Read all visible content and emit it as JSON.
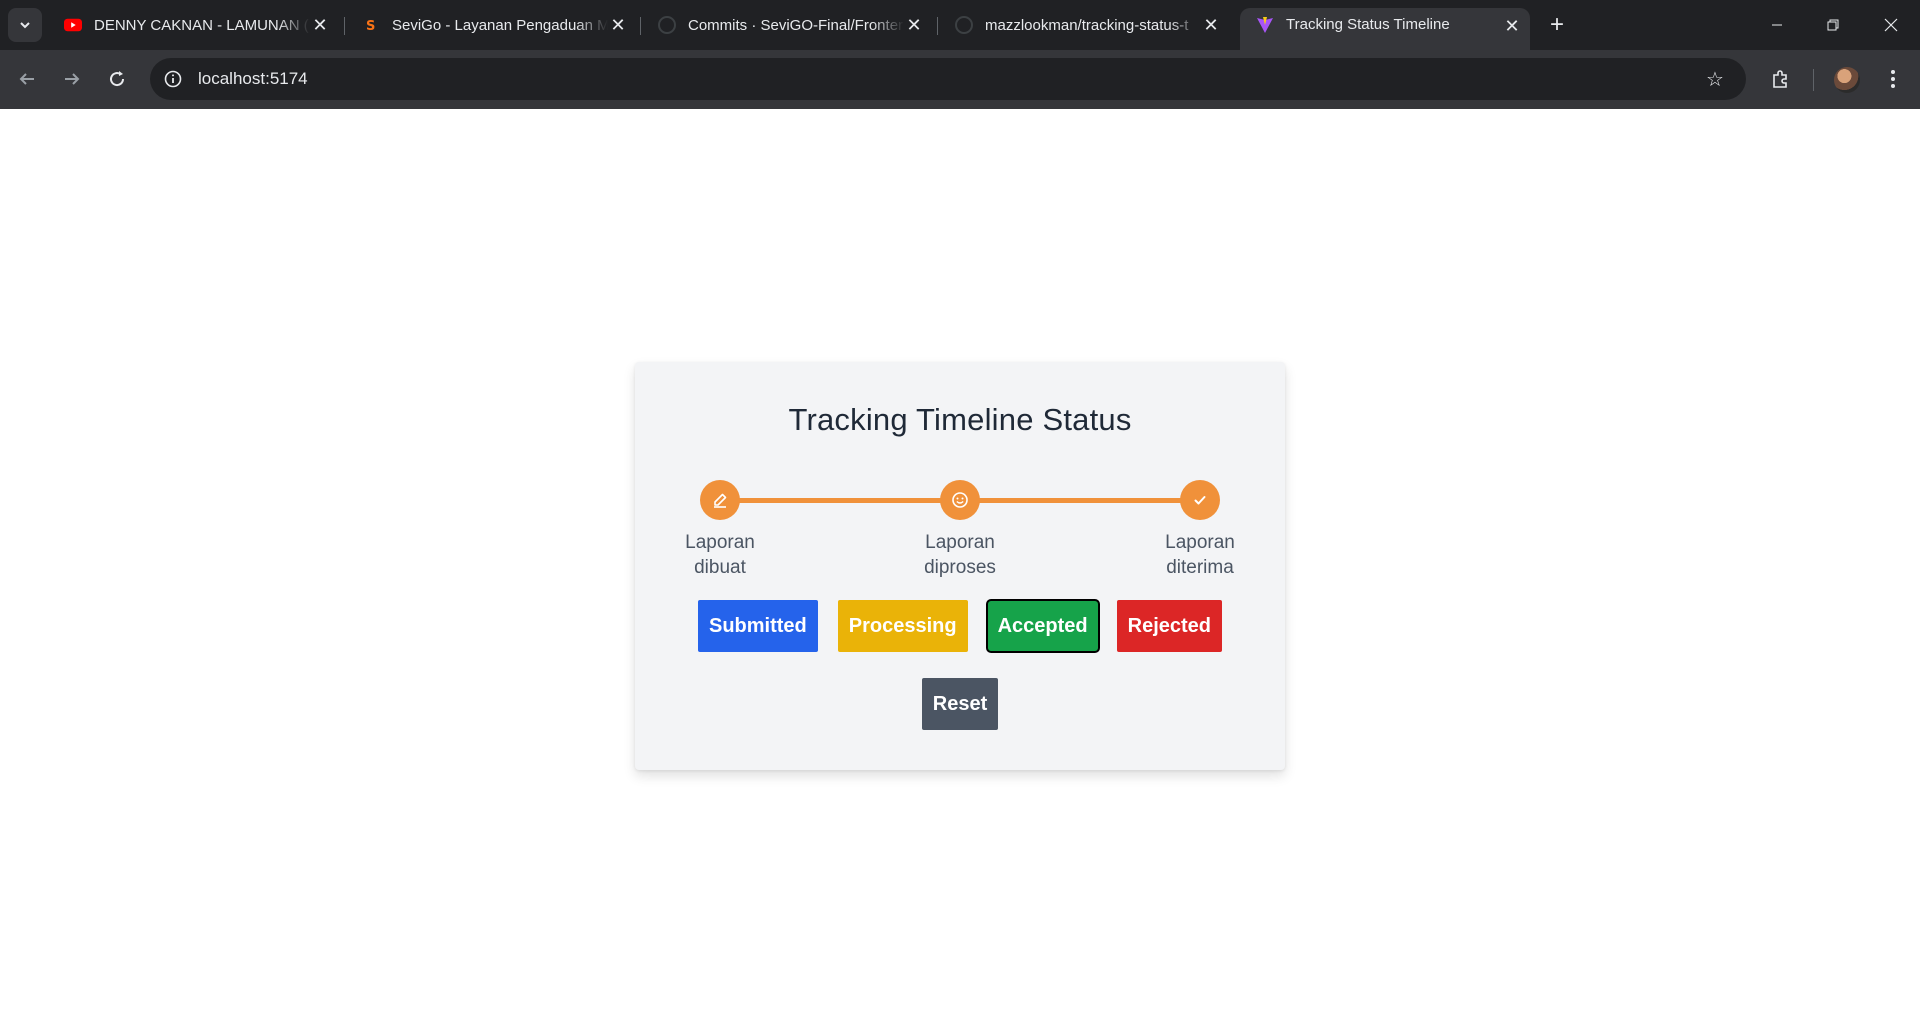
{
  "browser": {
    "tabs": [
      {
        "title": "DENNY CAKNAN - LAMUNAN (",
        "icon": "youtube-icon"
      },
      {
        "title": "SeviGo - Layanan Pengaduan M",
        "icon": "sevigo-icon"
      },
      {
        "title": "Commits · SeviGO-Final/Fronter",
        "icon": "github-icon"
      },
      {
        "title": "mazzlookman/tracking-status-t",
        "icon": "github-icon"
      },
      {
        "title": "Tracking Status Timeline",
        "icon": "vite-icon"
      }
    ],
    "url": "localhost:5174"
  },
  "page": {
    "title": "Tracking Timeline Status",
    "accent": "#f0913a",
    "steps": [
      {
        "line1": "Laporan",
        "line2": "dibuat",
        "icon": "pencil-icon"
      },
      {
        "line1": "Laporan",
        "line2": "diproses",
        "icon": "smiley-icon"
      },
      {
        "line1": "Laporan",
        "line2": "diterima",
        "icon": "check-icon"
      }
    ],
    "buttons": {
      "submitted": "Submitted",
      "processing": "Processing",
      "accepted": "Accepted",
      "rejected": "Rejected",
      "reset": "Reset"
    }
  }
}
